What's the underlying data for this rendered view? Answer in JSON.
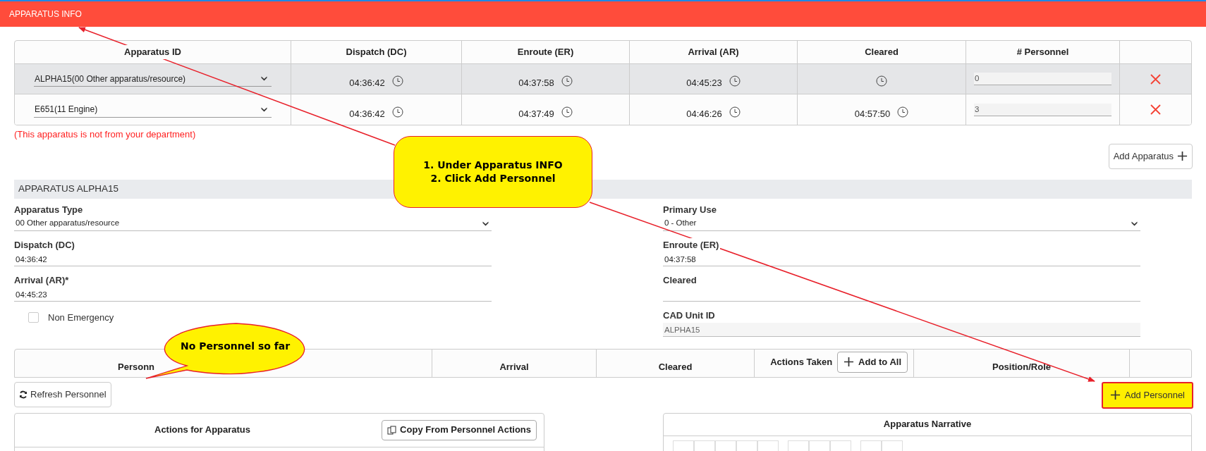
{
  "header": {
    "title": "APPARATUS INFO"
  },
  "apparatus_table": {
    "columns": [
      "Apparatus ID",
      "Dispatch (DC)",
      "Enroute (ER)",
      "Arrival (AR)",
      "Cleared",
      "# Personnel"
    ],
    "rows": [
      {
        "apparatus": "ALPHA15(00 Other apparatus/resource)",
        "selected": true,
        "dispatch": "04:36:42",
        "enroute": "04:37:58",
        "arrival": "04:45:23",
        "personnel": "0"
      },
      {
        "apparatus": "E651(11 Engine)",
        "selected": false,
        "dispatch": "04:36:42",
        "enroute": "04:37:49",
        "arrival": "04:46:26",
        "cleared": "04:57:50",
        "personnel": "3"
      }
    ]
  },
  "error_message": "(This apparatus is not from your department)",
  "add_apparatus_button": "Add Apparatus",
  "detail": {
    "title": "APPARATUS ALPHA15",
    "left_fields": [
      {
        "label": "Apparatus Type",
        "value": "00 Other apparatus/resource",
        "kind": "select"
      },
      {
        "label": "Dispatch (DC)",
        "value": "04:36:42",
        "kind": "text"
      },
      {
        "label": "Arrival (AR)*",
        "value": "04:45:23",
        "kind": "text"
      }
    ],
    "non_emergency": {
      "label": "Non Emergency",
      "checked": false
    },
    "right_fields": [
      {
        "label": "Primary Use",
        "value": "0 - Other",
        "kind": "select"
      },
      {
        "label": "Enroute (ER)",
        "value": "04:37:58",
        "kind": "text"
      },
      {
        "label": "Cleared",
        "kind": "text"
      },
      {
        "label": "CAD Unit ID",
        "value": "ALPHA15",
        "kind": "readonly"
      }
    ]
  },
  "personnel_table": {
    "columns": [
      {
        "label": "Personn"
      },
      {
        "label": "Arrival"
      },
      {
        "label": "Cleared"
      },
      {
        "label": "Actions Taken",
        "button": "Add to All"
      },
      {
        "label": "Position/Role"
      }
    ]
  },
  "refresh_button": "Refresh Personnel",
  "add_personnel_button": {
    "label": "Add Personnel",
    "highlighted": true
  },
  "actions_card": {
    "title": "Actions for Apparatus",
    "copy_button": "Copy From Personnel Actions"
  },
  "narrative": {
    "title": "Apparatus Narrative"
  },
  "annotations": {
    "callout": [
      "1. Under Apparatus INFO",
      "2. Click Add Personnel"
    ],
    "bubble": "No Personnel so far"
  }
}
